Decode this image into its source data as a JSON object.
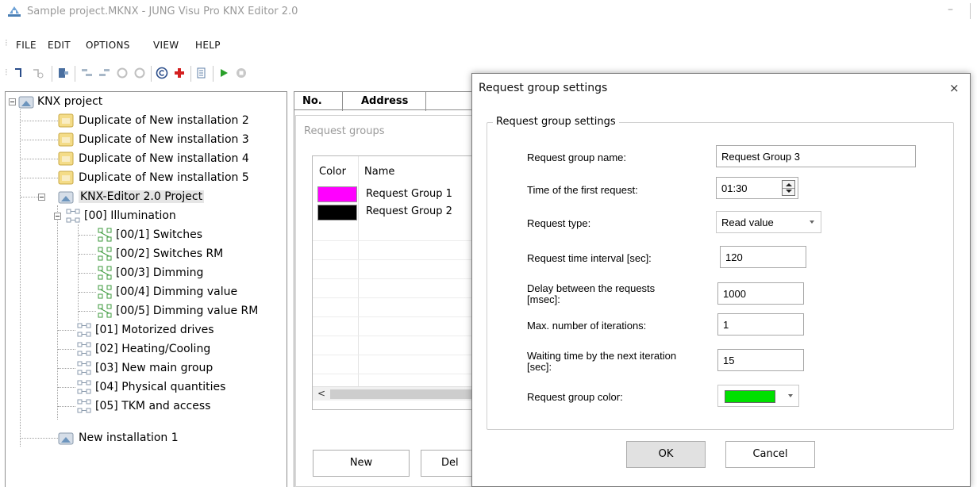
{
  "window": {
    "title": "Sample project.MKNX - JUNG Visu Pro KNX Editor 2.0",
    "minimize": "–"
  },
  "menu": [
    "FILE",
    "EDIT",
    "OPTIONS",
    "VIEW",
    "HELP"
  ],
  "toolbar": {
    "icons": [
      "new-group-icon",
      "new-subgroup-icon",
      "import-icon",
      "expand-icon",
      "collapse-icon",
      "undo-icon",
      "redo-icon",
      "copyright-icon",
      "add-icon",
      "properties-icon",
      "play-icon",
      "stop-icon"
    ]
  },
  "tree": {
    "root": "KNX project",
    "items": [
      "Duplicate of New installation 2",
      "Duplicate of New installation 3",
      "Duplicate of New installation 4",
      "Duplicate of New installation 5",
      "KNX-Editor 2.0 Project",
      "[00] Illumination",
      "[00/1] Switches",
      "[00/2] Switches RM",
      "[00/3] Dimming",
      "[00/4] Dimming value",
      "[00/5] Dimming value RM",
      "[01] Motorized drives",
      "[02] Heating/Cooling",
      "[03] New main group",
      "[04] Physical quantities",
      "[05] TKM and access",
      "New installation 1"
    ]
  },
  "table": {
    "col_no": "No.",
    "col_address": "Address"
  },
  "request_groups": {
    "title": "Request groups",
    "col_color": "Color",
    "col_name": "Name",
    "rows": [
      {
        "color": "#ff00ff",
        "name": "Request Group 1"
      },
      {
        "color": "#000000",
        "name": "Request Group 2"
      }
    ],
    "scroll_left": "<",
    "new_button": "New",
    "delete_button": "Del"
  },
  "dialog": {
    "title": "Request group settings",
    "close": "×",
    "legend": "Request group settings",
    "fields": {
      "name_label": "Request group name:",
      "name_value": "Request Group 3",
      "first_request_label": "Time of the first request:",
      "first_request_value": "01:30",
      "request_type_label": "Request type:",
      "request_type_value": "Read value",
      "interval_label": "Request time interval [sec]:",
      "interval_value": "120",
      "delay_label_1": "Delay between the requests",
      "delay_label_2": "[msec]:",
      "delay_value": "1000",
      "iterations_label": "Max. number of iterations:",
      "iterations_value": "1",
      "waiting_label_1": "Waiting time by the next iteration",
      "waiting_label_2": "[sec]:",
      "waiting_value": "15",
      "color_label": "Request group color:",
      "color_value": "#00e000"
    },
    "ok_button": "OK",
    "cancel_button": "Cancel"
  }
}
